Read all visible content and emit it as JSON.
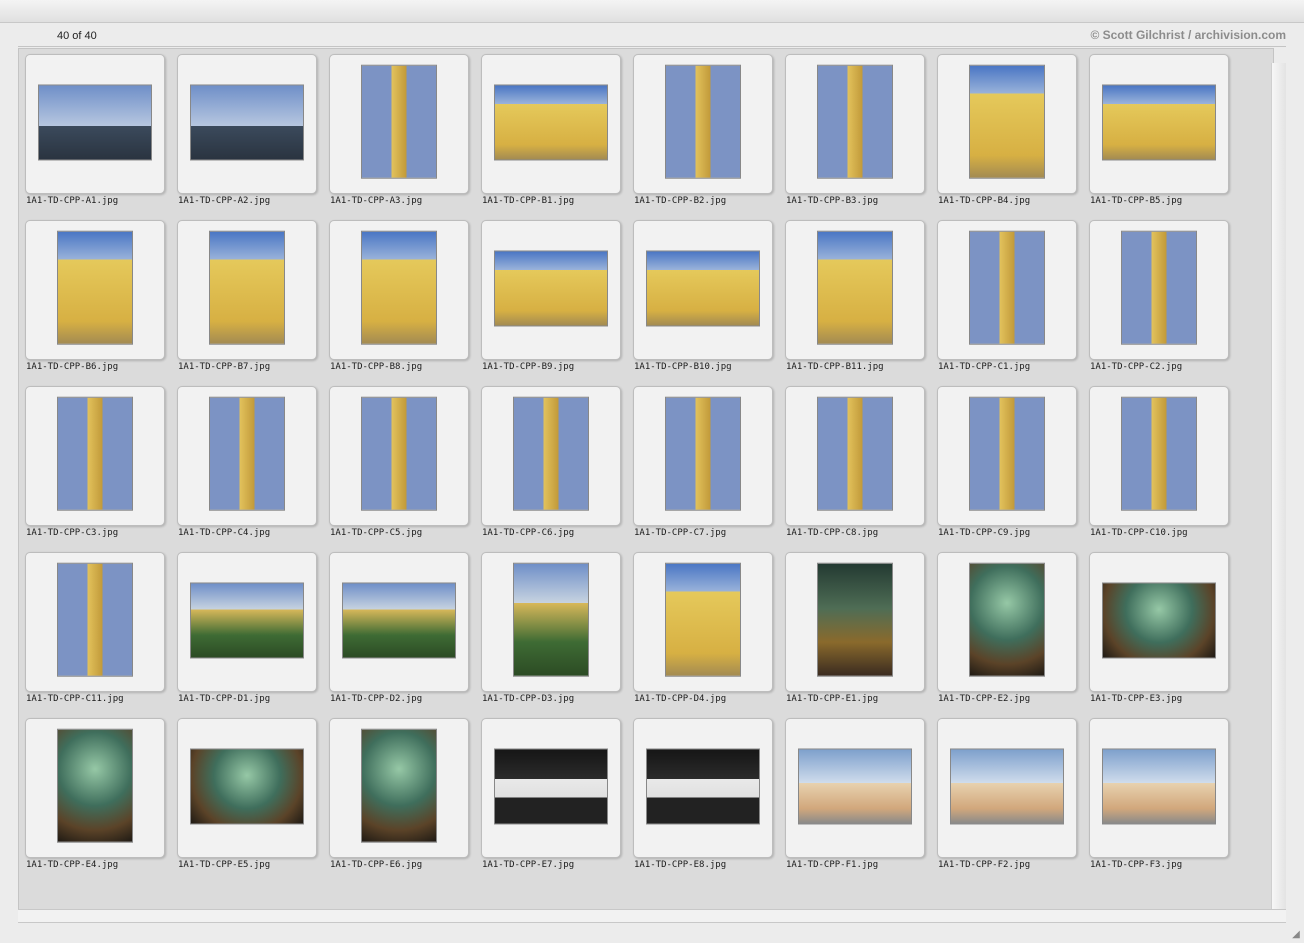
{
  "header": {
    "count": "40 of 40",
    "copyright": "© Scott Gilchrist / archivision.com"
  },
  "slides": [
    {
      "label": "1A1-TD-CPP-A1.jpg",
      "style": "sky2",
      "orient": "h"
    },
    {
      "label": "1A1-TD-CPP-A2.jpg",
      "style": "sky2",
      "orient": "h"
    },
    {
      "label": "1A1-TD-CPP-A3.jpg",
      "style": "spire",
      "orient": "v"
    },
    {
      "label": "1A1-TD-CPP-B1.jpg",
      "style": "yellow",
      "orient": "h"
    },
    {
      "label": "1A1-TD-CPP-B2.jpg",
      "style": "spire",
      "orient": "v"
    },
    {
      "label": "1A1-TD-CPP-B3.jpg",
      "style": "spire",
      "orient": "v"
    },
    {
      "label": "1A1-TD-CPP-B4.jpg",
      "style": "yellow",
      "orient": "v"
    },
    {
      "label": "1A1-TD-CPP-B5.jpg",
      "style": "yellow",
      "orient": "h"
    },
    {
      "label": "1A1-TD-CPP-B6.jpg",
      "style": "yellow",
      "orient": "v"
    },
    {
      "label": "1A1-TD-CPP-B7.jpg",
      "style": "yellow",
      "orient": "v"
    },
    {
      "label": "1A1-TD-CPP-B8.jpg",
      "style": "yellow",
      "orient": "v"
    },
    {
      "label": "1A1-TD-CPP-B9.jpg",
      "style": "yellow",
      "orient": "h"
    },
    {
      "label": "1A1-TD-CPP-B10.jpg",
      "style": "yellow",
      "orient": "h"
    },
    {
      "label": "1A1-TD-CPP-B11.jpg",
      "style": "yellow",
      "orient": "v"
    },
    {
      "label": "1A1-TD-CPP-C1.jpg",
      "style": "spire",
      "orient": "v"
    },
    {
      "label": "1A1-TD-CPP-C2.jpg",
      "style": "spire",
      "orient": "v"
    },
    {
      "label": "1A1-TD-CPP-C3.jpg",
      "style": "spire",
      "orient": "v"
    },
    {
      "label": "1A1-TD-CPP-C4.jpg",
      "style": "spire",
      "orient": "v"
    },
    {
      "label": "1A1-TD-CPP-C5.jpg",
      "style": "spire",
      "orient": "v"
    },
    {
      "label": "1A1-TD-CPP-C6.jpg",
      "style": "spire",
      "orient": "v"
    },
    {
      "label": "1A1-TD-CPP-C7.jpg",
      "style": "spire",
      "orient": "v"
    },
    {
      "label": "1A1-TD-CPP-C8.jpg",
      "style": "spire",
      "orient": "v"
    },
    {
      "label": "1A1-TD-CPP-C9.jpg",
      "style": "spire",
      "orient": "v"
    },
    {
      "label": "1A1-TD-CPP-C10.jpg",
      "style": "spire",
      "orient": "v"
    },
    {
      "label": "1A1-TD-CPP-C11.jpg",
      "style": "spire",
      "orient": "v"
    },
    {
      "label": "1A1-TD-CPP-D1.jpg",
      "style": "park",
      "orient": "h"
    },
    {
      "label": "1A1-TD-CPP-D2.jpg",
      "style": "park",
      "orient": "h"
    },
    {
      "label": "1A1-TD-CPP-D3.jpg",
      "style": "park",
      "orient": "v"
    },
    {
      "label": "1A1-TD-CPP-D4.jpg",
      "style": "yellow",
      "orient": "v"
    },
    {
      "label": "1A1-TD-CPP-E1.jpg",
      "style": "dark",
      "orient": "v"
    },
    {
      "label": "1A1-TD-CPP-E2.jpg",
      "style": "interior",
      "orient": "v"
    },
    {
      "label": "1A1-TD-CPP-E3.jpg",
      "style": "interior",
      "orient": "h"
    },
    {
      "label": "1A1-TD-CPP-E4.jpg",
      "style": "interior",
      "orient": "v"
    },
    {
      "label": "1A1-TD-CPP-E5.jpg",
      "style": "interior",
      "orient": "h"
    },
    {
      "label": "1A1-TD-CPP-E6.jpg",
      "style": "interior",
      "orient": "v"
    },
    {
      "label": "1A1-TD-CPP-E7.jpg",
      "style": "tomb",
      "orient": "h"
    },
    {
      "label": "1A1-TD-CPP-E8.jpg",
      "style": "tomb",
      "orient": "h"
    },
    {
      "label": "1A1-TD-CPP-F1.jpg",
      "style": "house",
      "orient": "h"
    },
    {
      "label": "1A1-TD-CPP-F2.jpg",
      "style": "house",
      "orient": "h"
    },
    {
      "label": "1A1-TD-CPP-F3.jpg",
      "style": "house",
      "orient": "h"
    }
  ]
}
